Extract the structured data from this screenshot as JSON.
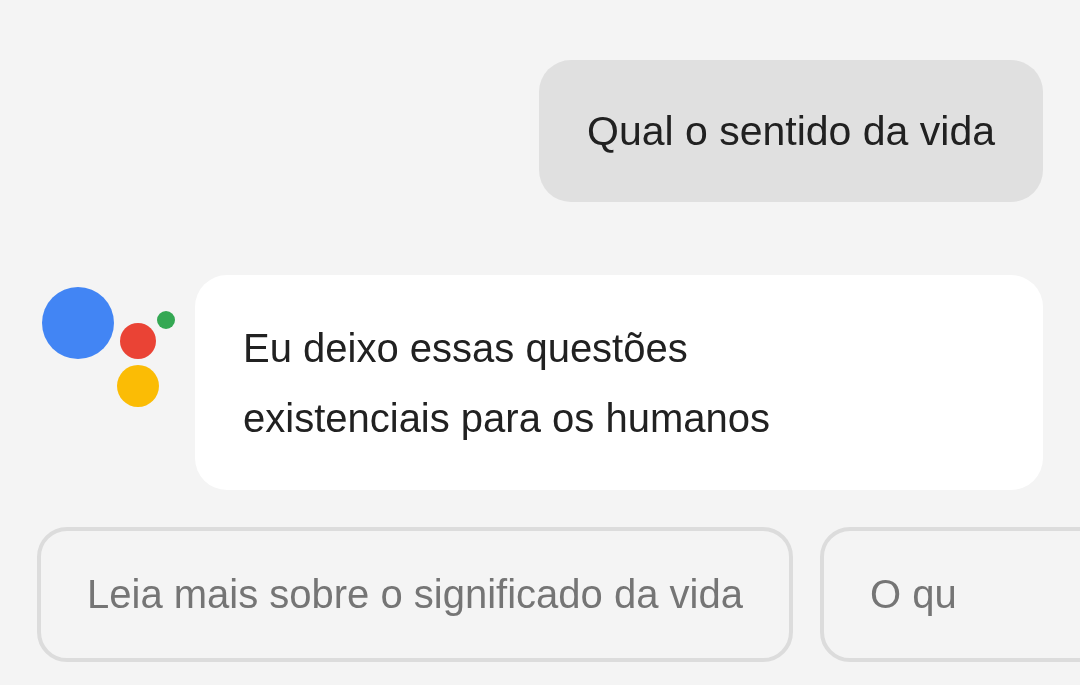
{
  "conversation": [
    {
      "kind": "user",
      "text": "Qual o sentido da vida"
    },
    {
      "kind": "assistant",
      "text": "Eu deixo essas questões existenciais para os humanos"
    }
  ],
  "suggestions": [
    "Leia mais sobre o significado da vida",
    "O qu"
  ]
}
